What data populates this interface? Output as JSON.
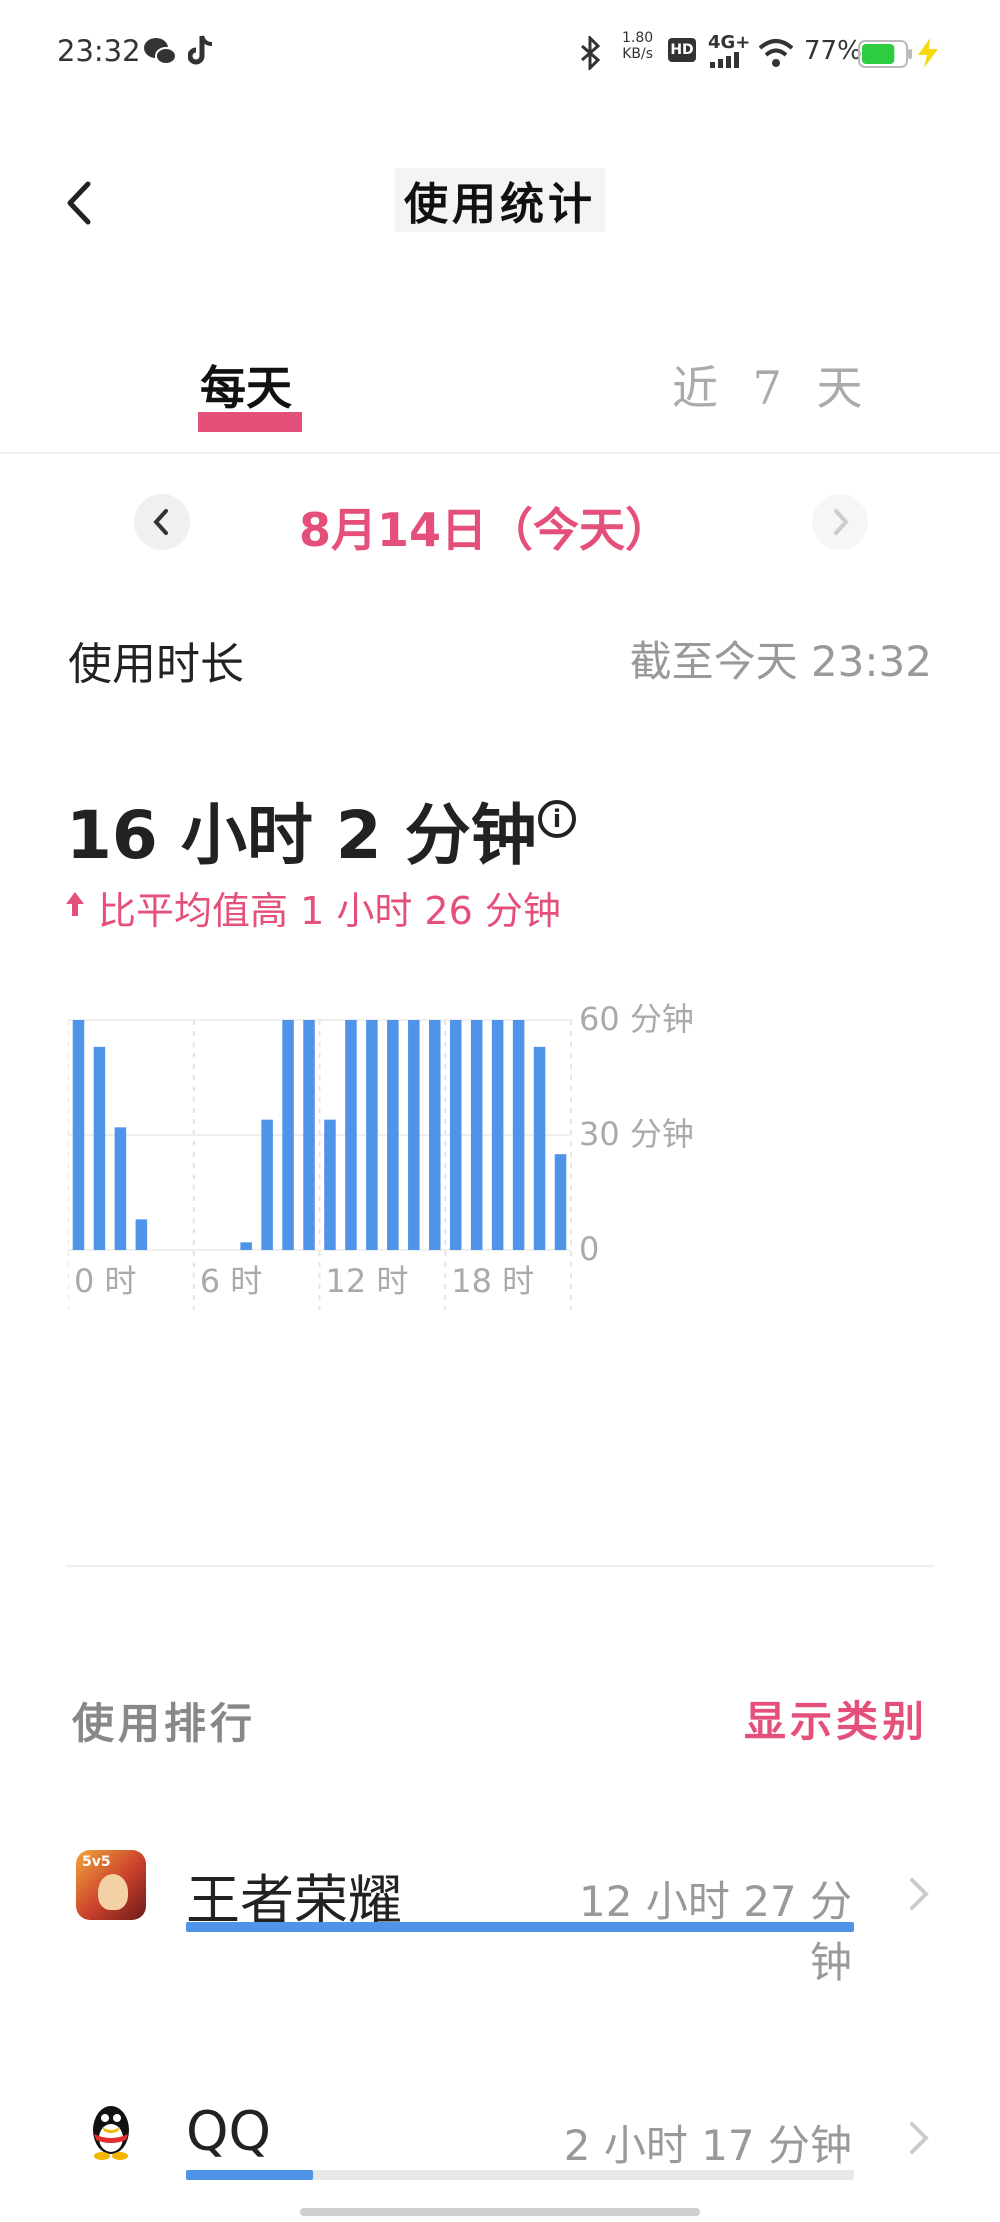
{
  "status_bar": {
    "time": "23:32",
    "speed_top": "1.80",
    "speed_bottom": "KB/s",
    "hd": "HD",
    "network": "4G+",
    "battery": "77%",
    "icons": [
      "wechat-icon",
      "tiktok-icon",
      "bluetooth-icon",
      "signal-icon",
      "wifi-icon",
      "battery-icon",
      "charging-icon"
    ],
    "battery_level": 0.77,
    "colors": {
      "battery": "#2ecc40",
      "charging": "#f5d90a"
    }
  },
  "header": {
    "title": "使用统计",
    "back_icon": "chevron-left-icon"
  },
  "tabs": [
    {
      "label": "每天",
      "active": true
    },
    {
      "label": "近 7 天",
      "active": false
    }
  ],
  "date_nav": {
    "label": "8月14日（今天）"
  },
  "usage": {
    "label": "使用时长",
    "as_of": "截至今天 23:32",
    "total": "16 小时 2 分钟",
    "comparison": "比平均值高 1 小时 26 分钟"
  },
  "chart_data": {
    "type": "bar",
    "x_unit": "hour",
    "categories": [
      "0",
      "1",
      "2",
      "3",
      "4",
      "5",
      "6",
      "7",
      "8",
      "9",
      "10",
      "11",
      "12",
      "13",
      "14",
      "15",
      "16",
      "17",
      "18",
      "19",
      "20",
      "21",
      "22",
      "23"
    ],
    "values": [
      60,
      53,
      32,
      8,
      0,
      0,
      0,
      0,
      2,
      34,
      60,
      60,
      34,
      60,
      60,
      60,
      60,
      60,
      60,
      60,
      60,
      60,
      53,
      25
    ],
    "ylim": [
      0,
      60
    ],
    "y_ticks": [
      "0",
      "30 分钟",
      "60 分钟"
    ],
    "x_ticks": [
      "0 时",
      "6 时",
      "12 时",
      "18 时"
    ],
    "bar_color": "#4f94e8",
    "grid": true
  },
  "ranking": {
    "title": "使用排行",
    "toggle": "显示类别",
    "apps": [
      {
        "name": "王者荣耀",
        "time": "12 小时 27 分钟",
        "fraction": 1.0,
        "icon": "honor-of-kings-icon"
      },
      {
        "name": "QQ",
        "time": "2 小时 17 分钟",
        "fraction": 0.19,
        "icon": "qq-penguin-icon"
      }
    ]
  },
  "colors": {
    "accent": "#e5507a",
    "bar": "#4f94e8"
  }
}
